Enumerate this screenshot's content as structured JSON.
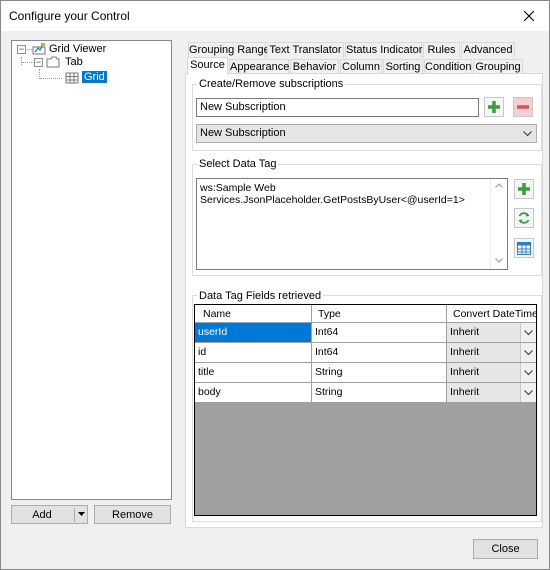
{
  "window": {
    "title": "Configure your Control",
    "close_label": "×"
  },
  "tree": {
    "root": "Grid Viewer",
    "child": "Tab",
    "grandchild": "Grid",
    "root_expander": "−",
    "child_expander": "−"
  },
  "left_buttons": {
    "add": "Add",
    "remove": "Remove"
  },
  "tabs": {
    "row1": [
      "Grouping Range",
      "Text Translator",
      "Status Indicator",
      "Rules",
      "Advanced"
    ],
    "row2": [
      "Source",
      "Appearance",
      "Behavior",
      "Column",
      "Sorting",
      "Condition",
      "Grouping"
    ],
    "active": "Source"
  },
  "subscriptions": {
    "group_label": "Create/Remove subscriptions",
    "input_value": "New Subscription",
    "select_value": "New Subscription"
  },
  "data_tag": {
    "group_label": "Select Data Tag",
    "value_line1": "ws:Sample Web",
    "value_line2": "Services.JsonPlaceholder.GetPostsByUser<@userId=1>"
  },
  "fields": {
    "group_label": "Data Tag Fields retrieved",
    "columns": [
      "Name",
      "Type",
      "Convert DateTime"
    ],
    "rows": [
      {
        "name": "userId",
        "type": "Int64",
        "convert": "Inherit"
      },
      {
        "name": "id",
        "type": "Int64",
        "convert": "Inherit"
      },
      {
        "name": "title",
        "type": "String",
        "convert": "Inherit"
      },
      {
        "name": "body",
        "type": "String",
        "convert": "Inherit"
      }
    ]
  },
  "footer": {
    "close": "Close"
  },
  "colors": {
    "accent": "#0078d7",
    "add_green": "#3c9d3c",
    "remove_red": "#d9534f"
  },
  "icons": [
    "close-icon",
    "plus-icon",
    "minus-icon",
    "refresh-icon",
    "table-icon",
    "chevron-down-icon",
    "grid-icon",
    "tab-icon",
    "grid-viewer-icon"
  ]
}
